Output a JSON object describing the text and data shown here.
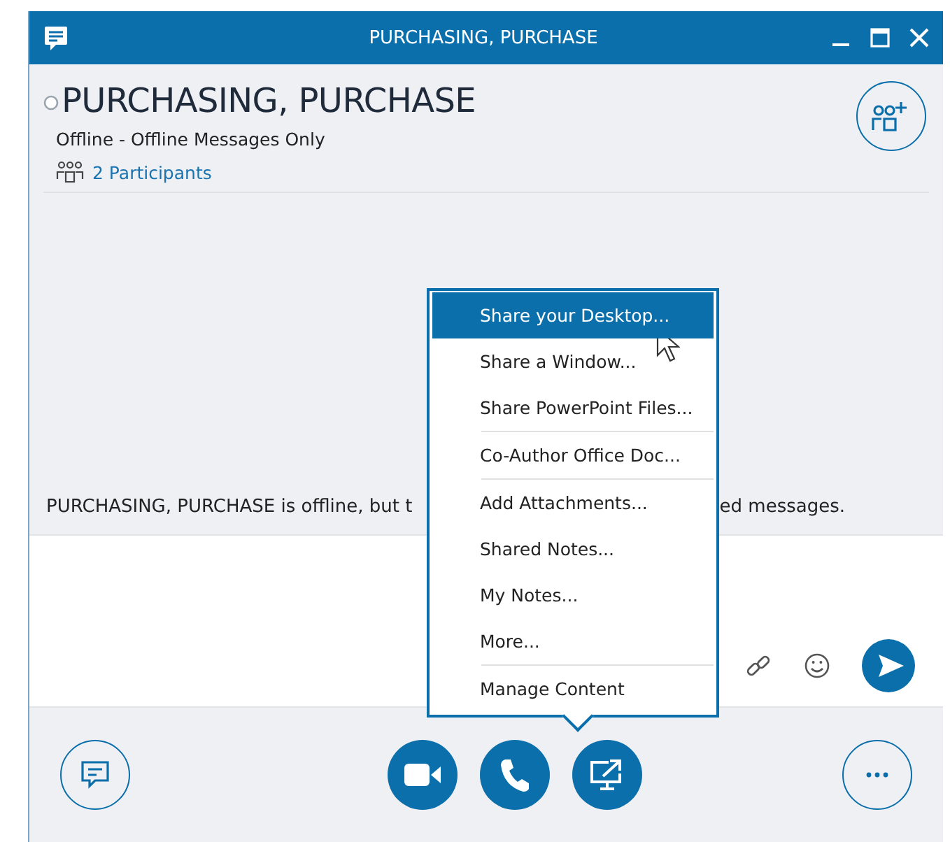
{
  "window": {
    "title": "PURCHASING, PURCHASE"
  },
  "contact": {
    "name": "PURCHASING, PURCHASE",
    "status": "Offline - Offline Messages Only",
    "participants": "2 Participants"
  },
  "notice": {
    "left": "PURCHASING, PURCHASE is offline, but t",
    "right": "ed messages."
  },
  "share_menu": {
    "items": [
      {
        "label": "Share your Desktop...",
        "selected": true,
        "divider_above": false
      },
      {
        "label": "Share a Window...",
        "selected": false,
        "divider_above": false
      },
      {
        "label": "Share PowerPoint Files...",
        "selected": false,
        "divider_above": false
      },
      {
        "label": "Co-Author Office Doc...",
        "selected": false,
        "divider_above": true
      },
      {
        "label": "Add Attachments...",
        "selected": false,
        "divider_above": true
      },
      {
        "label": "Shared Notes...",
        "selected": false,
        "divider_above": false
      },
      {
        "label": "My Notes...",
        "selected": false,
        "divider_above": false
      },
      {
        "label": "More...",
        "selected": false,
        "divider_above": false
      },
      {
        "label": "Manage Content",
        "selected": false,
        "divider_above": true
      }
    ]
  },
  "bottom_buttons": [
    {
      "kind": "chat"
    },
    {
      "kind": "video"
    },
    {
      "kind": "phone"
    },
    {
      "kind": "share"
    },
    {
      "kind": "more"
    }
  ]
}
